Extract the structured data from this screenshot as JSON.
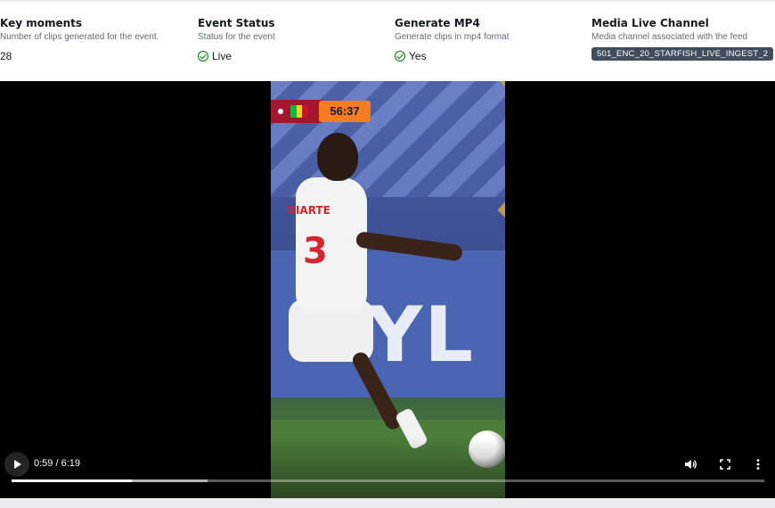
{
  "stats": [
    {
      "label": "Key moments",
      "description": "Number of clips generated for the event.",
      "value": "28"
    },
    {
      "label": "Event Status",
      "description": "Status for the event",
      "value": "Live"
    },
    {
      "label": "Generate MP4",
      "description": "Generate clips in mp4 format",
      "value": "Yes"
    },
    {
      "label": "Media Live Channel",
      "description": "Media channel associated with the feed",
      "value": "501_ENC_20_STARFISH_LIVE_INGEST_2"
    }
  ],
  "video": {
    "scoreboard_time": "56:37",
    "banner_text": "HYL",
    "jersey_name": "DIARTE",
    "jersey_number": "3",
    "time_display": "0:59 / 6:19",
    "progress_fraction": 0.16,
    "buffered_fraction": 0.26
  },
  "colors": {
    "status_green": "#037f0c",
    "badge_bg": "#414d5c",
    "timer_orange": "#f57c1f"
  },
  "icons": [
    "check-circle-icon",
    "play-icon",
    "volume-icon",
    "fullscreen-icon",
    "more-options-icon"
  ]
}
